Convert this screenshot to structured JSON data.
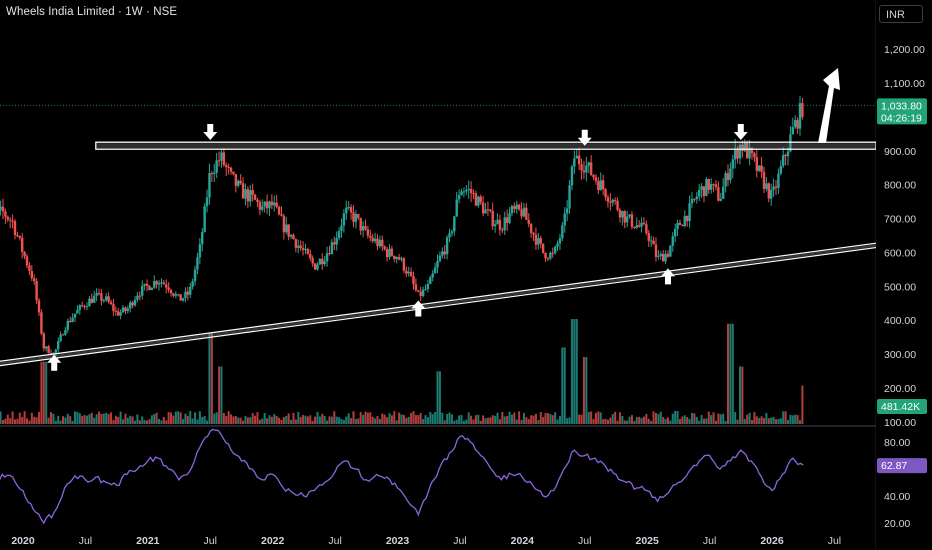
{
  "header": {
    "title": "Wheels India Limited · 1W · NSE",
    "currency": "INR"
  },
  "badges": {
    "last_price": "1,033.80",
    "countdown": "04:26:19",
    "volume": "481.42K",
    "rsi": "62.87"
  },
  "colors": {
    "background": "#000000",
    "up": "#26a69a",
    "down": "#ef5350",
    "rsi_line": "#8a66e0",
    "price_badge": "#22a37a",
    "rsi_badge": "#7e57c2",
    "annotation": "#ffffff"
  },
  "icons": [
    "down-arrow-icon",
    "up-arrow-icon",
    "breakout-arrow-icon"
  ],
  "chart_data": [
    {
      "type": "candlestick",
      "title": "Wheels India Limited · 1W · NSE",
      "ylabel": "INR",
      "ylim": [
        100,
        1280
      ],
      "y_ticks": [
        100,
        200,
        300,
        400,
        500,
        600,
        700,
        800,
        900,
        1000,
        1100,
        1200
      ],
      "y_tick_labels": [
        "100.00",
        "200.00",
        "300.00",
        "400.00",
        "500.00",
        "600.00",
        "700.00",
        "800.00",
        "900.00",
        "1,000.00",
        "1,100.00",
        "1,200.00"
      ],
      "x_ticks": [
        {
          "label": "2020",
          "date": "2020-01"
        },
        {
          "label": "Jul",
          "date": "2020-07"
        },
        {
          "label": "2021",
          "date": "2021-01"
        },
        {
          "label": "Jul",
          "date": "2021-07"
        },
        {
          "label": "2022",
          "date": "2022-01"
        },
        {
          "label": "Jul",
          "date": "2022-07"
        },
        {
          "label": "2023",
          "date": "2023-01"
        },
        {
          "label": "Jul",
          "date": "2023-07"
        },
        {
          "label": "2024",
          "date": "2024-01"
        },
        {
          "label": "Jul",
          "date": "2024-07"
        },
        {
          "label": "2025",
          "date": "2025-01"
        },
        {
          "label": "Jul",
          "date": "2025-07"
        },
        {
          "label": "2026",
          "date": "2026-01"
        },
        {
          "label": "Jul",
          "date": "2026-07"
        }
      ],
      "xlim": [
        "2019-09",
        "2026-12"
      ],
      "price_path": [
        [
          "2019-09",
          660
        ],
        [
          "2019-10",
          700
        ],
        [
          "2019-11",
          720
        ],
        [
          "2019-12",
          690
        ],
        [
          "2020-01",
          600
        ],
        [
          "2020-02",
          520
        ],
        [
          "2020-03",
          320
        ],
        [
          "2020-04",
          300
        ],
        [
          "2020-05",
          380
        ],
        [
          "2020-06",
          420
        ],
        [
          "2020-07",
          450
        ],
        [
          "2020-08",
          470
        ],
        [
          "2020-09",
          460
        ],
        [
          "2020-10",
          420
        ],
        [
          "2020-11",
          430
        ],
        [
          "2020-12",
          480
        ],
        [
          "2021-01",
          500
        ],
        [
          "2021-02",
          520
        ],
        [
          "2021-03",
          500
        ],
        [
          "2021-04",
          460
        ],
        [
          "2021-05",
          480
        ],
        [
          "2021-06",
          610
        ],
        [
          "2021-07",
          840
        ],
        [
          "2021-08",
          880
        ],
        [
          "2021-09",
          820
        ],
        [
          "2021-10",
          780
        ],
        [
          "2021-11",
          760
        ],
        [
          "2021-12",
          730
        ],
        [
          "2022-01",
          740
        ],
        [
          "2022-02",
          680
        ],
        [
          "2022-03",
          640
        ],
        [
          "2022-04",
          600
        ],
        [
          "2022-05",
          560
        ],
        [
          "2022-06",
          590
        ],
        [
          "2022-07",
          640
        ],
        [
          "2022-08",
          720
        ],
        [
          "2022-09",
          700
        ],
        [
          "2022-10",
          650
        ],
        [
          "2022-11",
          630
        ],
        [
          "2022-12",
          600
        ],
        [
          "2023-01",
          590
        ],
        [
          "2023-02",
          540
        ],
        [
          "2023-03",
          470
        ],
        [
          "2023-04",
          500
        ],
        [
          "2023-05",
          580
        ],
        [
          "2023-06",
          640
        ],
        [
          "2023-07",
          790
        ],
        [
          "2023-08",
          780
        ],
        [
          "2023-09",
          740
        ],
        [
          "2023-10",
          700
        ],
        [
          "2023-11",
          680
        ],
        [
          "2023-12",
          720
        ],
        [
          "2024-01",
          720
        ],
        [
          "2024-02",
          660
        ],
        [
          "2024-03",
          600
        ],
        [
          "2024-04",
          590
        ],
        [
          "2024-05",
          680
        ],
        [
          "2024-06",
          880
        ],
        [
          "2024-07",
          860
        ],
        [
          "2024-08",
          820
        ],
        [
          "2024-09",
          780
        ],
        [
          "2024-10",
          740
        ],
        [
          "2024-11",
          700
        ],
        [
          "2024-12",
          680
        ],
        [
          "2025-01",
          660
        ],
        [
          "2025-02",
          580
        ],
        [
          "2025-03",
          600
        ],
        [
          "2025-04",
          680
        ],
        [
          "2025-05",
          720
        ],
        [
          "2025-06",
          780
        ],
        [
          "2025-07",
          800
        ],
        [
          "2025-08",
          760
        ],
        [
          "2025-09",
          860
        ],
        [
          "2025-10",
          920
        ],
        [
          "2025-11",
          880
        ],
        [
          "2025-12",
          820
        ],
        [
          "2026-01",
          760
        ],
        [
          "2026-02",
          860
        ],
        [
          "2026-03",
          960
        ],
        [
          "2026-04",
          1033.8
        ]
      ],
      "annotations": {
        "resistance_line": {
          "from": [
            "2020-08",
            915
          ],
          "to": [
            "2026-12",
            915
          ]
        },
        "support_trendline": {
          "from": [
            "2019-09",
            265
          ],
          "to": [
            "2026-12",
            625
          ]
        },
        "down_arrows": [
          [
            "2021-07",
            985
          ],
          [
            "2024-07",
            968
          ],
          [
            "2025-10",
            985
          ]
        ],
        "up_arrows": [
          [
            "2020-04",
            245
          ],
          [
            "2023-03",
            405
          ],
          [
            "2025-03",
            500
          ]
        ]
      }
    },
    {
      "type": "bar",
      "title": "Volume",
      "last_value": "481.42K",
      "spikes": [
        [
          "2020-03",
          0.55
        ],
        [
          "2021-07",
          0.85
        ],
        [
          "2021-08",
          0.5
        ],
        [
          "2023-05",
          0.45
        ],
        [
          "2024-05",
          0.7
        ],
        [
          "2024-06",
          1.0
        ],
        [
          "2024-07",
          0.6
        ],
        [
          "2025-09",
          0.95
        ],
        [
          "2025-10",
          0.5
        ],
        [
          "2026-04",
          0.3
        ]
      ]
    },
    {
      "type": "line",
      "title": "RSI",
      "ylim": [
        15,
        95
      ],
      "y_ticks": [
        20,
        40,
        60,
        80
      ],
      "y_tick_labels": [
        "20.00",
        "40.00",
        "60.00",
        "80.00"
      ],
      "last_value": 62.87,
      "values": [
        [
          "2019-09",
          50
        ],
        [
          "2019-10",
          44
        ],
        [
          "2019-11",
          56
        ],
        [
          "2019-12",
          54
        ],
        [
          "2020-01",
          44
        ],
        [
          "2020-02",
          30
        ],
        [
          "2020-03",
          20
        ],
        [
          "2020-04",
          28
        ],
        [
          "2020-05",
          46
        ],
        [
          "2020-06",
          55
        ],
        [
          "2020-07",
          52
        ],
        [
          "2020-08",
          54
        ],
        [
          "2020-09",
          50
        ],
        [
          "2020-10",
          48
        ],
        [
          "2020-11",
          56
        ],
        [
          "2020-12",
          60
        ],
        [
          "2021-01",
          66
        ],
        [
          "2021-02",
          68
        ],
        [
          "2021-03",
          60
        ],
        [
          "2021-04",
          52
        ],
        [
          "2021-05",
          58
        ],
        [
          "2021-06",
          76
        ],
        [
          "2021-07",
          88
        ],
        [
          "2021-08",
          86
        ],
        [
          "2021-09",
          74
        ],
        [
          "2021-10",
          66
        ],
        [
          "2021-11",
          60
        ],
        [
          "2021-12",
          52
        ],
        [
          "2022-01",
          56
        ],
        [
          "2022-02",
          46
        ],
        [
          "2022-03",
          42
        ],
        [
          "2022-04",
          40
        ],
        [
          "2022-05",
          44
        ],
        [
          "2022-06",
          50
        ],
        [
          "2022-07",
          58
        ],
        [
          "2022-08",
          66
        ],
        [
          "2022-09",
          60
        ],
        [
          "2022-10",
          52
        ],
        [
          "2022-11",
          56
        ],
        [
          "2022-12",
          54
        ],
        [
          "2023-01",
          46
        ],
        [
          "2023-02",
          36
        ],
        [
          "2023-03",
          26
        ],
        [
          "2023-04",
          44
        ],
        [
          "2023-05",
          60
        ],
        [
          "2023-06",
          72
        ],
        [
          "2023-07",
          84
        ],
        [
          "2023-08",
          80
        ],
        [
          "2023-09",
          70
        ],
        [
          "2023-10",
          60
        ],
        [
          "2023-11",
          52
        ],
        [
          "2023-12",
          56
        ],
        [
          "2024-01",
          54
        ],
        [
          "2024-02",
          48
        ],
        [
          "2024-03",
          40
        ],
        [
          "2024-04",
          44
        ],
        [
          "2024-05",
          60
        ],
        [
          "2024-06",
          74
        ],
        [
          "2024-07",
          70
        ],
        [
          "2024-08",
          68
        ],
        [
          "2024-09",
          62
        ],
        [
          "2024-10",
          56
        ],
        [
          "2024-11",
          50
        ],
        [
          "2024-12",
          46
        ],
        [
          "2025-01",
          44
        ],
        [
          "2025-02",
          36
        ],
        [
          "2025-03",
          42
        ],
        [
          "2025-04",
          50
        ],
        [
          "2025-05",
          58
        ],
        [
          "2025-06",
          66
        ],
        [
          "2025-07",
          70
        ],
        [
          "2025-08",
          60
        ],
        [
          "2025-09",
          66
        ],
        [
          "2025-10",
          74
        ],
        [
          "2025-11",
          66
        ],
        [
          "2025-12",
          54
        ],
        [
          "2026-01",
          44
        ],
        [
          "2026-02",
          56
        ],
        [
          "2026-03",
          68
        ],
        [
          "2026-04",
          62.87
        ]
      ]
    }
  ]
}
